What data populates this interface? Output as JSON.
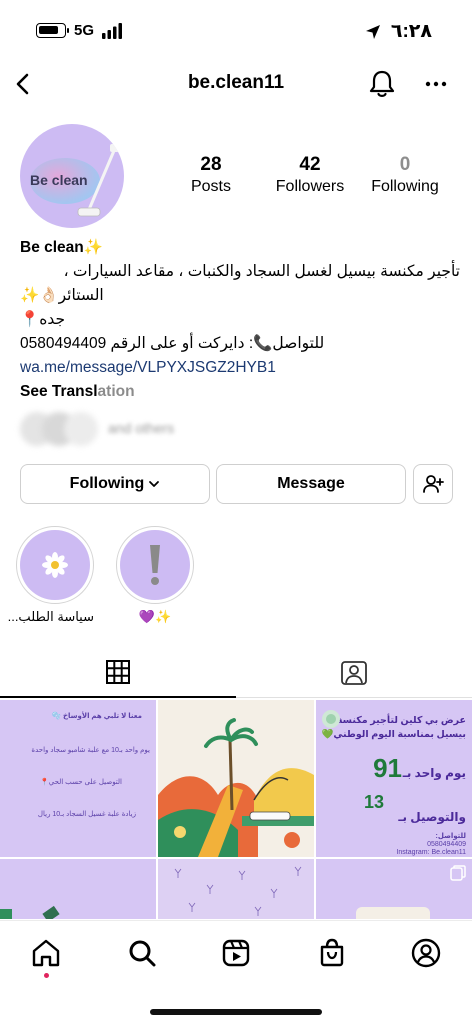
{
  "status_bar": {
    "time": "٦:٢٨",
    "network": "5G",
    "battery_level": 0.75,
    "battery-icon": "battery-icon",
    "signal_icon": "signal-icon",
    "location_icon": "location-arrow-icon"
  },
  "header": {
    "username": "be.clean11",
    "back_icon": "chevron-left-icon",
    "bell_icon": "bell-icon",
    "more_icon": "more-horizontal-icon"
  },
  "profile": {
    "avatar_text": "Be clean",
    "stats": [
      {
        "value": "28",
        "label": "Posts"
      },
      {
        "value": "42",
        "label": "Followers"
      },
      {
        "value": "0",
        "label": "Following"
      }
    ]
  },
  "bio": {
    "name": "Be clean✨",
    "line1": "تأجير مكنسة بيسيل لغسل السجاد والكنبات ، مقاعد السيارات ،",
    "line2": "الستائر👌🏻✨",
    "line3": "جده📍",
    "line4": "للتواصل📞: دايركت أو على الرقم 0580494409",
    "link": "wa.me/message/VLPYXJSGZ2HYB1",
    "see_translation_a": "See Transl",
    "see_translation_b": "ation"
  },
  "followed_by": {
    "text": "and others"
  },
  "buttons": {
    "following": "Following",
    "message": "Message",
    "add_user_icon": "add-user-icon"
  },
  "highlights": [
    {
      "label": "سياسة الطلب...",
      "icon": "daisy-icon"
    },
    {
      "label": "✨💜",
      "icon": "exclamation-icon"
    }
  ],
  "tabs": {
    "grid_icon": "grid-icon",
    "tagged_icon": "tagged-person-icon"
  },
  "posts": {
    "p1_lines": [
      "معنا لا تلبي هم الأوساخ 🫧",
      "يوم واحد بـ10 مع علبة شامبو سجاد واحدة",
      "التوصيل على حسب الحي📍",
      "زيادة علبة غسيل السجاد بـ10 ريال"
    ],
    "p3_lines": [
      "عرض بي كلين لتأجير مكنسة",
      "بيسيل بمناسبة اليوم الوطني💚",
      "يوم واحد بـ",
      "والتوصيل بـ",
      "للتواصل:",
      "0580494409",
      "Instagram: Be.clean11"
    ],
    "p3_prices": [
      "91",
      "13"
    ]
  },
  "bottom_nav": [
    "home-icon",
    "search-icon",
    "reels-icon",
    "shop-icon",
    "profile-icon"
  ]
}
